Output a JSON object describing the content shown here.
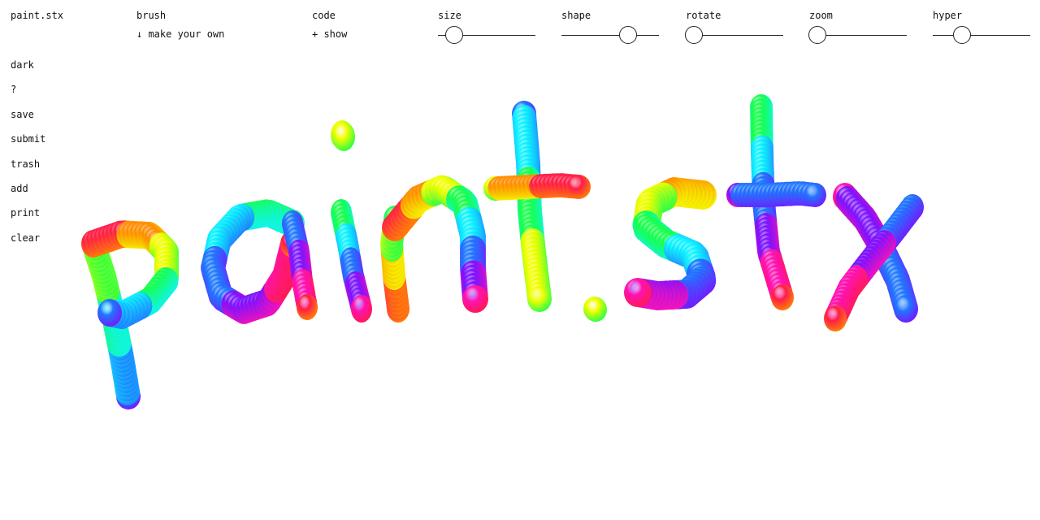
{
  "app": {
    "title": "paint.stx"
  },
  "header": {
    "brush": {
      "label": "brush",
      "action": "↓ make your own"
    },
    "code": {
      "label": "code",
      "action": "+ show"
    },
    "sliders": [
      {
        "id": "size",
        "label": "size",
        "value": 0.17
      },
      {
        "id": "shape",
        "label": "shape",
        "value": 0.68
      },
      {
        "id": "rotate",
        "label": "rotate",
        "value": 0.08
      },
      {
        "id": "zoom",
        "label": "zoom",
        "value": 0.08
      },
      {
        "id": "hyper",
        "label": "hyper",
        "value": 0.3
      }
    ]
  },
  "sidebar": {
    "items": [
      "dark",
      "?",
      "save",
      "submit",
      "trash",
      "add",
      "print",
      "clear"
    ]
  },
  "canvas": {
    "artwork": "paint.stx",
    "colors": {
      "red": "#ff1b4a",
      "orange": "#ff8a00",
      "yellow": "#f3ff00",
      "green": "#17ff4a",
      "cyan": "#0ff3ff",
      "blue": "#1e78ff",
      "violet": "#7b12ff",
      "magenta": "#ff12b4"
    }
  }
}
